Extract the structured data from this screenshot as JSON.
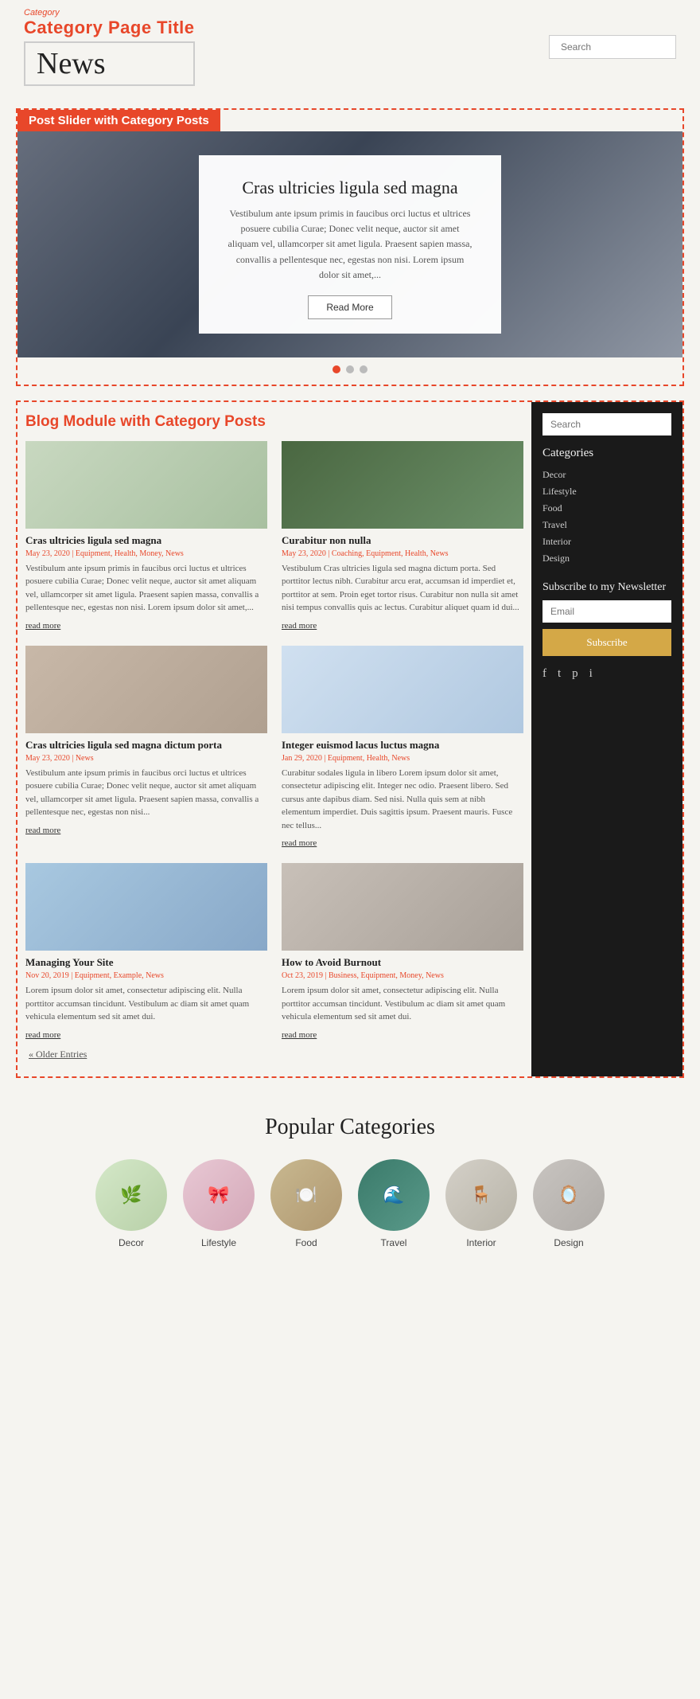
{
  "header": {
    "category_label": "Category",
    "page_title": "Category Page Title",
    "news_text": "News",
    "search_placeholder": "Search"
  },
  "slider": {
    "section_label": "Post Slider with Category Posts",
    "card": {
      "title": "Cras ultricies ligula sed magna",
      "text": "Vestibulum ante ipsum primis in faucibus orci luctus et ultrices posuere cubilia Curae; Donec velit neque, auctor sit amet aliquam vel, ullamcorper sit amet ligula. Praesent sapien massa, convallis a pellentesque nec, egestas non nisi. Lorem ipsum dolor sit amet,...",
      "read_more": "Read More"
    },
    "dots": [
      true,
      false,
      false
    ]
  },
  "blog": {
    "section_label": "Blog Module with Category Posts",
    "posts": [
      {
        "img_class": "sofa",
        "title": "Cras ultricies ligula sed magna",
        "meta": "May 23, 2020 | Equipment, Health, Money, News",
        "text": "Vestibulum ante ipsum primis in faucibus orci luctus et ultrices posuere cubilia Curae; Donec velit neque, auctor sit amet aliquam vel, ullamcorper sit amet ligula. Praesent sapien massa, convallis a pellentesque nec, egestas non nisi. Lorem ipsum dolor sit amet,...",
        "readmore": "read more"
      },
      {
        "img_class": "shelves",
        "title": "Curabitur non nulla",
        "meta": "May 23, 2020 | Coaching, Equipment, Health, News",
        "text": "Vestibulum Cras ultricies ligula sed magna dictum porta. Sed porttitor lectus nibh. Curabitur arcu erat, accumsan id imperdiet et, porttitor at sem. Proin eget tortor risus. Curabitur non nulla sit amet nisi tempus convallis quis ac lectus. Curabitur aliquet quam id dui...",
        "readmore": "read more"
      },
      {
        "img_class": "woman",
        "title": "Cras ultricies ligula sed magna dictum porta",
        "meta": "May 23, 2020 | News",
        "text": "Vestibulum ante ipsum primis in faucibus orci luctus et ultrices posuere cubilia Curae; Donec velit neque, auctor sit amet aliquam vel, ullamcorper sit amet ligula. Praesent sapien massa, convallis a pellentesque nec, egestas non nisi...",
        "readmore": "read more"
      },
      {
        "img_class": "room",
        "title": "Integer euismod lacus luctus magna",
        "meta": "Jan 29, 2020 | Equipment, Health, News",
        "text": "Curabitur sodales ligula in libero Lorem ipsum dolor sit amet, consectetur adipiscing elit. Integer nec odio. Praesent libero. Sed cursus ante dapibus diam. Sed nisi. Nulla quis sem at nibh elementum imperdiet. Duis sagittis ipsum. Praesent mauris. Fusce nec tellus...",
        "readmore": "read more"
      },
      {
        "img_class": "phone",
        "title": "Managing Your Site",
        "meta": "Nov 20, 2019 | Equipment, Example, News",
        "text": "Lorem ipsum dolor sit amet, consectetur adipiscing elit. Nulla porttitor accumsan tincidunt. Vestibulum ac diam sit amet quam vehicula elementum sed sit amet dui.",
        "readmore": "read more"
      },
      {
        "img_class": "person",
        "title": "How to Avoid Burnout",
        "meta": "Oct 23, 2019 | Business, Equipment, Money, News",
        "text": "Lorem ipsum dolor sit amet, consectetur adipiscing elit. Nulla porttitor accumsan tincidunt. Vestibulum ac diam sit amet quam vehicula elementum sed sit amet dui.",
        "readmore": "read more"
      }
    ],
    "older_entries": "« Older Entries"
  },
  "sidebar": {
    "search_placeholder": "Search",
    "categories_title": "Categories",
    "categories": [
      "Decor",
      "Lifestyle",
      "Food",
      "Travel",
      "Interior",
      "Design"
    ],
    "newsletter_title": "Subscribe to my Newsletter",
    "email_placeholder": "Email",
    "subscribe_label": "Subscribe",
    "social": [
      "f",
      "t",
      "p",
      "i"
    ]
  },
  "popular": {
    "title": "Popular Categories",
    "items": [
      {
        "label": "Decor",
        "class": "popular-circle-decor",
        "emoji": "🌿"
      },
      {
        "label": "Lifestyle",
        "class": "popular-circle-lifestyle",
        "emoji": "🎀"
      },
      {
        "label": "Food",
        "class": "popular-circle-food",
        "emoji": "🍽️"
      },
      {
        "label": "Travel",
        "class": "popular-circle-travel",
        "emoji": "🌊"
      },
      {
        "label": "Interior",
        "class": "popular-circle-interior",
        "emoji": "🪑"
      },
      {
        "label": "Design",
        "class": "popular-circle-design",
        "emoji": "🪞"
      }
    ]
  }
}
